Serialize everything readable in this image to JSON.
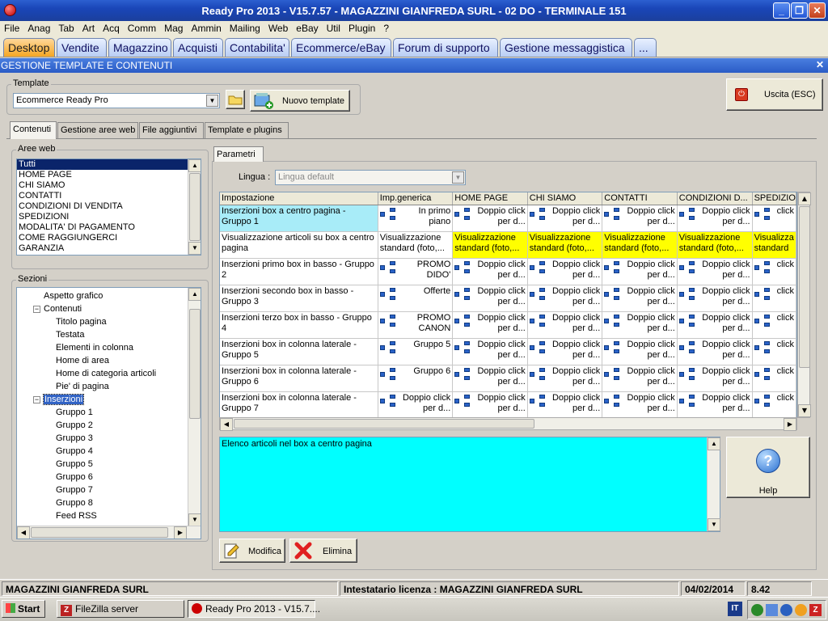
{
  "window": {
    "title": "Ready Pro 2013 - V15.7.57 - MAGAZZINI GIANFREDA SURL - 02 DO - TERMINALE 151",
    "minimize": "_",
    "restore": "❐",
    "close": "✕"
  },
  "menu": [
    "File",
    "Anag",
    "Tab",
    "Art",
    "Acq",
    "Comm",
    "Mag",
    "Ammin",
    "Mailing",
    "Web",
    "eBay",
    "Util",
    "Plugin",
    "?"
  ],
  "module_tabs": [
    "Desktop",
    "Vendite",
    "Magazzino",
    "Acquisti",
    "Contabilita'",
    "Ecommerce/eBay",
    "Forum di supporto",
    "Gestione messaggistica",
    "..."
  ],
  "panel": {
    "title": "GESTIONE TEMPLATE E CONTENUTI",
    "close": "✕"
  },
  "template": {
    "label": "Template",
    "value": "Ecommerce Ready Pro",
    "new_button": "Nuovo template"
  },
  "exit_button": "Uscita (ESC)",
  "sub_tabs": [
    "Contenuti",
    "Gestione aree web",
    "File aggiuntivi",
    "Template e plugins"
  ],
  "aree_web": {
    "label": "Aree web",
    "items": [
      "Tutti",
      "HOME PAGE",
      "CHI SIAMO",
      "CONTATTI",
      "CONDIZIONI DI VENDITA",
      "SPEDIZIONI",
      "MODALITA' DI PAGAMENTO",
      "COME RAGGIUNGERCI",
      "GARANZIA"
    ]
  },
  "sezioni": {
    "label": "Sezioni",
    "items": [
      {
        "label": "Aspetto grafico",
        "level": 1,
        "exp": ""
      },
      {
        "label": "Contenuti",
        "level": 1,
        "exp": "−"
      },
      {
        "label": "Titolo pagina",
        "level": 2,
        "exp": ""
      },
      {
        "label": "Testata",
        "level": 2,
        "exp": ""
      },
      {
        "label": "Elementi in colonna",
        "level": 2,
        "exp": ""
      },
      {
        "label": "Home di area",
        "level": 2,
        "exp": ""
      },
      {
        "label": "Home di categoria articoli",
        "level": 2,
        "exp": ""
      },
      {
        "label": "Pie' di pagina",
        "level": 2,
        "exp": ""
      },
      {
        "label": "Inserzioni",
        "level": 1,
        "exp": "−",
        "selected": true
      },
      {
        "label": "Gruppo 1",
        "level": 2,
        "exp": ""
      },
      {
        "label": "Gruppo 2",
        "level": 2,
        "exp": ""
      },
      {
        "label": "Gruppo 3",
        "level": 2,
        "exp": ""
      },
      {
        "label": "Gruppo 4",
        "level": 2,
        "exp": ""
      },
      {
        "label": "Gruppo 5",
        "level": 2,
        "exp": ""
      },
      {
        "label": "Gruppo 6",
        "level": 2,
        "exp": ""
      },
      {
        "label": "Gruppo 7",
        "level": 2,
        "exp": ""
      },
      {
        "label": "Gruppo 8",
        "level": 2,
        "exp": ""
      },
      {
        "label": "Feed RSS",
        "level": 2,
        "exp": ""
      }
    ]
  },
  "parametri": {
    "tab": "Parametri",
    "lingua_label": "Lingua :",
    "lingua_value": "Lingua default"
  },
  "grid": {
    "columns": [
      "Impostazione",
      "Imp.generica",
      "HOME PAGE",
      "CHI SIAMO",
      "CONTATTI",
      "CONDIZIONI D...",
      "SPEDIZIO"
    ],
    "rows": [
      {
        "name": "Inserzioni box a centro pagina - Gruppo 1",
        "generic": "In primo piano",
        "cells": [
          "Doppio click per d...",
          "Doppio click per d...",
          "Doppio click per d...",
          "Doppio click per d...",
          "click"
        ],
        "selected": true,
        "yellow": false,
        "generic_icon": true
      },
      {
        "name": "Visualizzazione articoli su box a centro pagina",
        "generic": "Visualizzazione standard (foto,...",
        "cells": [
          "Visualizzazione standard (foto,...",
          "Visualizzazione standard (foto,...",
          "Visualizzazione standard (foto,...",
          "Visualizzazione standard (foto,...",
          "Visualizza standard"
        ],
        "selected": false,
        "yellow": true,
        "generic_icon": false
      },
      {
        "name": "Inserzioni primo box in basso - Gruppo 2",
        "generic": "PROMO DIDO'",
        "cells": [
          "Doppio click per d...",
          "Doppio click per d...",
          "Doppio click per d...",
          "Doppio click per d...",
          "click"
        ],
        "selected": false,
        "yellow": false,
        "generic_icon": true
      },
      {
        "name": "Inserzioni secondo box in basso - Gruppo 3",
        "generic": "Offerte",
        "cells": [
          "Doppio click per d...",
          "Doppio click per d...",
          "Doppio click per d...",
          "Doppio click per d...",
          "click"
        ],
        "selected": false,
        "yellow": false,
        "generic_icon": true
      },
      {
        "name": "Inserzioni terzo box in basso - Gruppo 4",
        "generic": "PROMO CANON",
        "cells": [
          "Doppio click per d...",
          "Doppio click per d...",
          "Doppio click per d...",
          "Doppio click per d...",
          "click"
        ],
        "selected": false,
        "yellow": false,
        "generic_icon": true
      },
      {
        "name": "Inserzioni box in colonna laterale - Gruppo 5",
        "generic": "Gruppo 5",
        "cells": [
          "Doppio click per d...",
          "Doppio click per d...",
          "Doppio click per d...",
          "Doppio click per d...",
          "click"
        ],
        "selected": false,
        "yellow": false,
        "generic_icon": true
      },
      {
        "name": "Inserzioni box in colonna laterale - Gruppo 6",
        "generic": "Gruppo 6",
        "cells": [
          "Doppio click per d...",
          "Doppio click per d...",
          "Doppio click per d...",
          "Doppio click per d...",
          "click"
        ],
        "selected": false,
        "yellow": false,
        "generic_icon": true
      },
      {
        "name": "Inserzioni box in colonna laterale - Gruppo 7",
        "generic": "Doppio click per d...",
        "cells": [
          "Doppio click per d...",
          "Doppio click per d...",
          "Doppio click per d...",
          "Doppio click per d...",
          "click"
        ],
        "selected": false,
        "yellow": false,
        "generic_icon": true
      }
    ]
  },
  "description": "Elenco articoli nel box a centro pagina",
  "help_button": "Help",
  "modifica_button": "Modifica",
  "elimina_button": "Elimina",
  "status": {
    "company": "MAGAZZINI GIANFREDA SURL",
    "license": "Intestatario licenza : MAGAZZINI GIANFREDA SURL",
    "date": "04/02/2014",
    "version": "8.42"
  },
  "taskbar": {
    "start": "Start",
    "items": [
      "FileZilla server",
      "Ready Pro 2013 - V15.7...."
    ],
    "tray_it": "IT"
  },
  "colors": {
    "selected_row": "#a8ecf8",
    "yellow_cells": "#ffff00",
    "description_bg": "#00ffff",
    "active_tab": "#f5a623"
  }
}
